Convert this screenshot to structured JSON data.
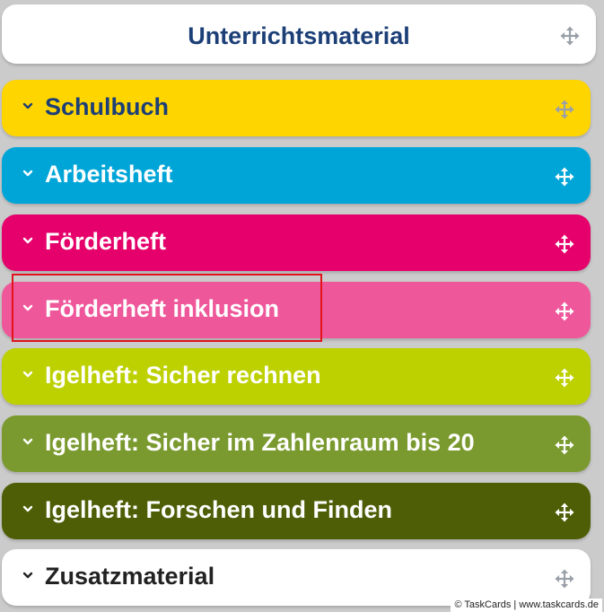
{
  "header": {
    "title": "Unterrichtsmaterial",
    "title_color": "#1c3f77",
    "move_icon": "move-arrows-icon"
  },
  "sections": [
    {
      "label": "Schulbuch",
      "bg": "#ffd500",
      "fg": "#1c3f77",
      "icon_color": "#9aa0a8"
    },
    {
      "label": "Arbeitsheft",
      "bg": "#00a5d8",
      "fg": "#ffffff",
      "icon_color": "#ffffff"
    },
    {
      "label": "Förderheft",
      "bg": "#e5006b",
      "fg": "#ffffff",
      "icon_color": "#ffffff"
    },
    {
      "label": "Förderheft inklusion",
      "bg": "#ef579b",
      "fg": "#ffffff",
      "icon_color": "#ffffff"
    },
    {
      "label": "Igelheft: Sicher rechnen",
      "bg": "#bdd000",
      "fg": "#ffffff",
      "icon_color": "#ffffff"
    },
    {
      "label": "Igelheft: Sicher im Zahlenraum bis 20",
      "bg": "#7a9a2f",
      "fg": "#ffffff",
      "icon_color": "#ffffff"
    },
    {
      "label": "Igelheft: Forschen und Finden",
      "bg": "#4e5e06",
      "fg": "#ffffff",
      "icon_color": "#ffffff"
    },
    {
      "label": "Zusatzmaterial",
      "bg": "#ffffff",
      "fg": "#222222",
      "icon_color": "#9aa0a8"
    }
  ],
  "footer": {
    "text": "© TaskCards | www.taskcards.de"
  },
  "highlight_color": "#e2131b"
}
